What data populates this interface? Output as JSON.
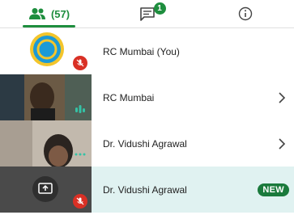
{
  "tabs": {
    "participants_count": "(57)",
    "chat_badge": "1"
  },
  "participants": [
    {
      "name": "RC Mumbai (You)"
    },
    {
      "name": "RC Mumbai"
    },
    {
      "name": "Dr. Vidushi Agrawal"
    },
    {
      "name": "Dr. Vidushi Agrawal",
      "badge": "NEW"
    }
  ],
  "colors": {
    "accent": "#1e8e3e",
    "muted_mic": "#d93025",
    "highlight_row": "#e0f2f1"
  }
}
